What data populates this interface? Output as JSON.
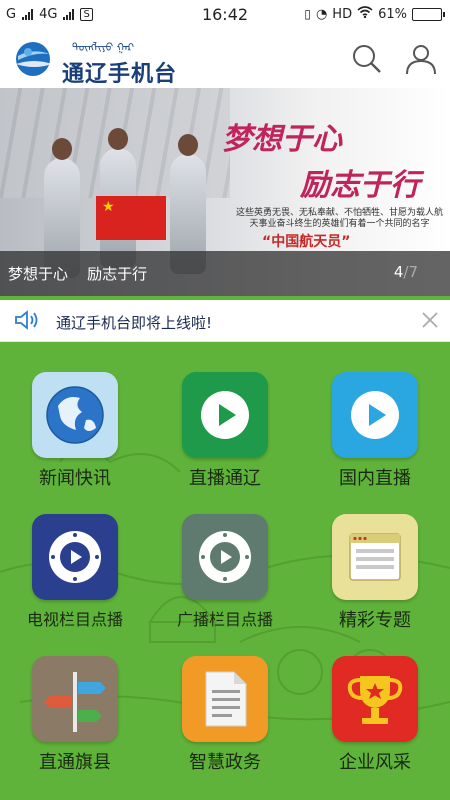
{
  "status_bar": {
    "carrier": "G",
    "network": "4G",
    "notif_box": "S",
    "time": "16:42",
    "hd": "HD",
    "battery": "61%",
    "battery_level": 0.61
  },
  "header": {
    "title": "通辽手机台",
    "mongolian": "ᠲᠥᠩᠯᠢᠶᠣ ᠭᠠᠷ",
    "logo_icon": "globe-logo-icon",
    "search_icon": "search-icon",
    "user_icon": "user-icon"
  },
  "banner": {
    "slogan_line1": "梦想于心",
    "slogan_line2": "励志于行",
    "body_text": "这些英勇无畏、无私奉献、不怕牺牲、甘愿为载人航天事业奋斗终生的英雄们有着一个共同的名字",
    "name": "“中国航天员”",
    "caption": "梦想于心    励志于行",
    "page_current": "4",
    "page_total": "/7",
    "slogan_color": "#c0245a"
  },
  "notice": {
    "icon": "speaker-icon",
    "text": "通辽手机台即将上线啦!",
    "close_icon": "close-icon"
  },
  "grid": {
    "background": "#5fb33a",
    "items": [
      {
        "label": "新闻快讯",
        "icon": "globe-icon",
        "color": "#bfe0f2"
      },
      {
        "label": "直播通辽",
        "icon": "play-icon",
        "color": "#1e9a4a"
      },
      {
        "label": "国内直播",
        "icon": "play-icon",
        "color": "#2aa6e0"
      },
      {
        "label": "电视栏目点播",
        "icon": "vod-play-icon",
        "color": "#2b3f8f"
      },
      {
        "label": "广播栏目点播",
        "icon": "vod-play-icon",
        "color": "#5f7a6e"
      },
      {
        "label": "精彩专题",
        "icon": "web-page-icon",
        "color": "#e9e19a"
      },
      {
        "label": "直通旗县",
        "icon": "signpost-icon",
        "color": "#8a7a66"
      },
      {
        "label": "智慧政务",
        "icon": "document-icon",
        "color": "#f19a25"
      },
      {
        "label": "企业风采",
        "icon": "trophy-icon",
        "color": "#e02a23"
      }
    ]
  }
}
